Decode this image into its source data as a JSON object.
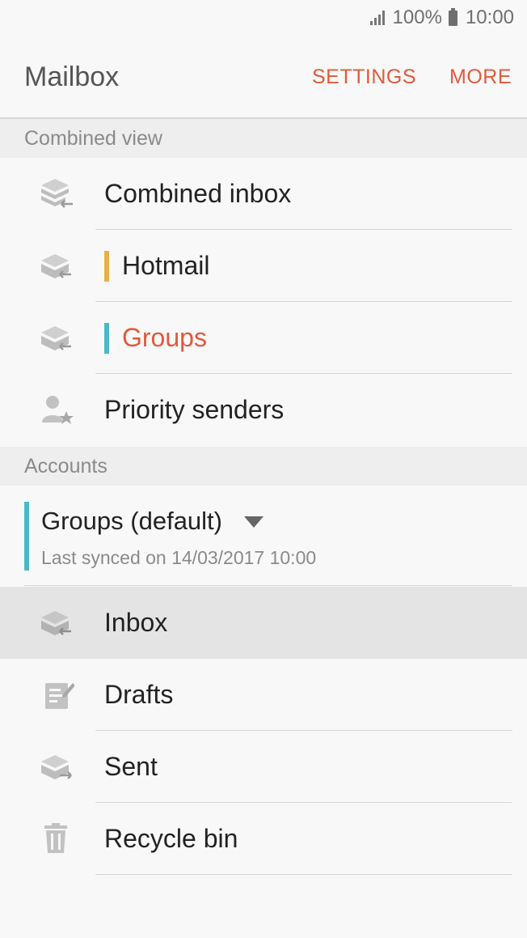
{
  "status_bar": {
    "battery": "100%",
    "time": "10:00",
    "signal_icon": "signal-bars-icon",
    "battery_icon": "battery-icon"
  },
  "app_bar": {
    "title": "Mailbox",
    "settings_label": "SETTINGS",
    "more_label": "MORE",
    "accent_color": "#e05a3a"
  },
  "combined_view": {
    "header": "Combined view",
    "items": [
      {
        "label": "Combined inbox",
        "icon": "combined-inbox-icon"
      },
      {
        "label": "Hotmail",
        "icon": "inbox-icon",
        "color": "#e8b04a"
      },
      {
        "label": "Groups",
        "icon": "inbox-icon",
        "color": "#4bb8c8"
      },
      {
        "label": "Priority senders",
        "icon": "priority-sender-icon"
      }
    ]
  },
  "accounts": {
    "header": "Accounts",
    "current_account": {
      "name": "Groups (default)",
      "last_synced": "Last synced on 14/03/2017  10:00",
      "color": "#4bb8c8"
    },
    "folders": [
      {
        "label": "Inbox",
        "icon": "inbox-icon",
        "selected": true
      },
      {
        "label": "Drafts",
        "icon": "drafts-icon"
      },
      {
        "label": "Sent",
        "icon": "sent-icon"
      },
      {
        "label": "Recycle bin",
        "icon": "trash-icon"
      }
    ]
  }
}
